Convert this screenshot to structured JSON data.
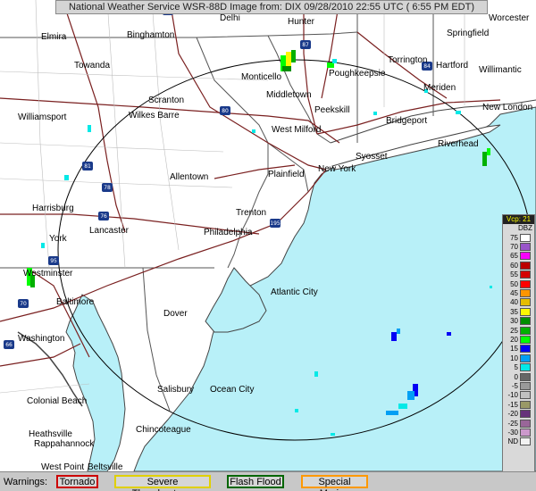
{
  "title": "National Weather Service WSR-88D Image from: DIX 09/28/2010 22:55 UTC ( 6:55 PM EDT)",
  "cities": [
    "Elmira",
    "Binghamton",
    "Delhi",
    "Hunter",
    "Worcester",
    "Springfield",
    "Towanda",
    "Monticello",
    "Poughkeepsie",
    "Torrington",
    "Hartford",
    "Willimantic",
    "Meriden",
    "New London",
    "Scranton",
    "Wilkes Barre",
    "Middletown",
    "Peekskill",
    "Williamsport",
    "West Milford",
    "Bridgeport",
    "Riverhead",
    "Syosset",
    "New York",
    "Allentown",
    "Plainfield",
    "Harrisburg",
    "Trenton",
    "York",
    "Lancaster",
    "Philadelphia",
    "Westminster",
    "Baltimore",
    "Atlantic City",
    "Dover",
    "Washington",
    "Colonial Beach",
    "Salisbury",
    "Ocean City",
    "Heathsville",
    "Rappahannock",
    "Chincoteague",
    "West Point",
    "Beltsville"
  ],
  "highway_shields": [
    "88",
    "87",
    "84",
    "80",
    "81",
    "78",
    "76",
    "195",
    "95",
    "70",
    "66"
  ],
  "legend": {
    "header": "Vcp: 21",
    "unit": "DBZ",
    "levels": [
      {
        "label": "75",
        "color": "#ffffff"
      },
      {
        "label": "70",
        "color": "#9955c9"
      },
      {
        "label": "65",
        "color": "#f800fd"
      },
      {
        "label": "60",
        "color": "#bc0000"
      },
      {
        "label": "55",
        "color": "#d40000"
      },
      {
        "label": "50",
        "color": "#fd0000"
      },
      {
        "label": "45",
        "color": "#fd9500"
      },
      {
        "label": "40",
        "color": "#e5bc00"
      },
      {
        "label": "35",
        "color": "#fdf802"
      },
      {
        "label": "30",
        "color": "#008e00"
      },
      {
        "label": "25",
        "color": "#01b000"
      },
      {
        "label": "20",
        "color": "#02fd02"
      },
      {
        "label": "15",
        "color": "#0300f4"
      },
      {
        "label": "10",
        "color": "#019ff4"
      },
      {
        "label": "5",
        "color": "#04e9e7"
      },
      {
        "label": "0",
        "color": "#666666"
      },
      {
        "label": "-5",
        "color": "#999999"
      },
      {
        "label": "-10",
        "color": "#c0c0c0"
      },
      {
        "label": "-15",
        "color": "#999966"
      },
      {
        "label": "-20",
        "color": "#66337a"
      },
      {
        "label": "-25",
        "color": "#996699"
      },
      {
        "label": "-30",
        "color": "#cc99cc"
      },
      {
        "label": "ND",
        "color": "#f2f2f2"
      }
    ]
  },
  "warnings": {
    "label": "Warnings:",
    "items": [
      {
        "label": "Tornado",
        "color": "#cc0000"
      },
      {
        "label": "Severe Thunderstorm",
        "color": "#e0d000"
      },
      {
        "label": "Flash Flood",
        "color": "#006600"
      },
      {
        "label": "Special Marine",
        "color": "#ff9900"
      }
    ]
  },
  "colors": {
    "ocean": "#b8f0f8",
    "land": "#ffffff",
    "roads": "#7a2020",
    "borders": "#555555"
  }
}
